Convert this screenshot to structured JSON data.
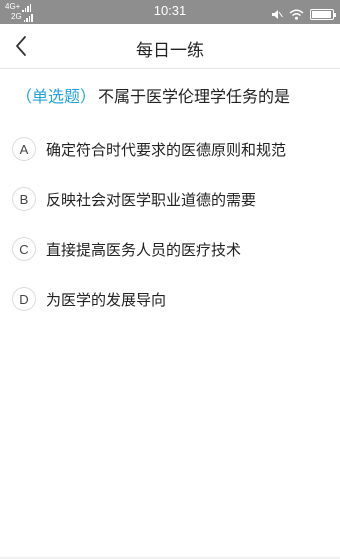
{
  "status_bar": {
    "network_top": "4G+",
    "network_bottom": "2G",
    "time": "10:31",
    "battery_level": 0.95
  },
  "header": {
    "title": "每日一练",
    "back_icon": "chevron-left-icon"
  },
  "question": {
    "type_label": "（单选题）",
    "text": "不属于医学伦理学任务的是"
  },
  "options": [
    {
      "letter": "A",
      "text": "确定符合时代要求的医德原则和规范"
    },
    {
      "letter": "B",
      "text": "反映社会对医学职业道德的需要"
    },
    {
      "letter": "C",
      "text": "直接提高医务人员的医疗技术"
    },
    {
      "letter": "D",
      "text": "为医学的发展导向"
    }
  ],
  "colors": {
    "status_bar": "#8e8e8e",
    "accent": "#2aa1d6",
    "text": "#222222"
  }
}
